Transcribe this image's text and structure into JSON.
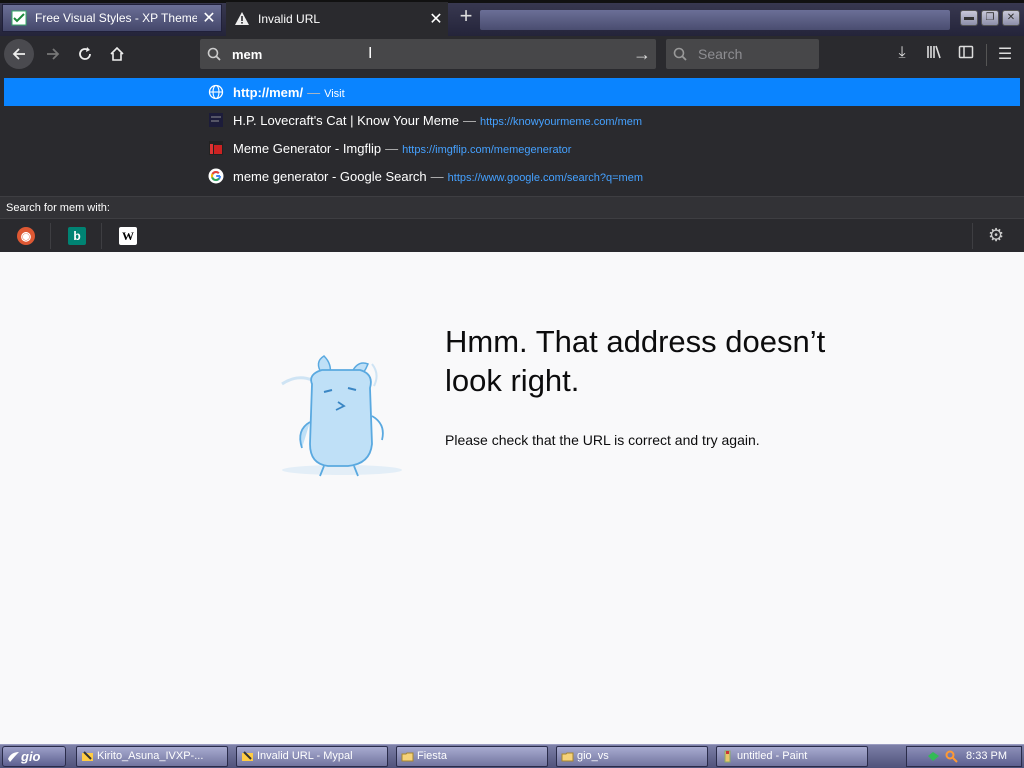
{
  "browser": {
    "tabs": [
      {
        "label": "Free Visual Styles - XP Themes - F",
        "active": false
      },
      {
        "label": "Invalid URL",
        "active": true
      }
    ],
    "new_tab_label": "+"
  },
  "toolbar": {
    "url_value": "mem",
    "search_placeholder": "Search"
  },
  "autocomplete": {
    "items": [
      {
        "title": "http://mem/",
        "separator": "—",
        "action": "Visit",
        "url": "",
        "icon": "globe-icon",
        "selected": true
      },
      {
        "title": "H.P. Lovecraft's Cat | Know Your Meme",
        "separator": "—",
        "action": "",
        "url": "https://knowyourmeme.com/mem",
        "icon": "knowyourmeme-icon",
        "selected": false
      },
      {
        "title": "Meme Generator - Imgflip",
        "separator": "—",
        "action": "",
        "url": "https://imgflip.com/memegenerator",
        "icon": "imgflip-icon",
        "selected": false
      },
      {
        "title": "meme generator - Google Search",
        "separator": "—",
        "action": "",
        "url": "https://www.google.com/search?q=mem",
        "icon": "google-icon",
        "selected": false
      }
    ],
    "search_with_label": "Search for mem with:",
    "engines": [
      "duckduckgo-icon",
      "bing-icon",
      "wikipedia-icon"
    ]
  },
  "error_page": {
    "title": "Hmm. That address doesn’t look right.",
    "description": "Please check that the URL is correct and try again."
  },
  "taskbar": {
    "start_label": "gio",
    "tasks": [
      {
        "label": "Kirito_Asuna_IVXP-..."
      },
      {
        "label": "Invalid URL - Mypal"
      },
      {
        "label": "Fiesta"
      },
      {
        "label": "gio_vs"
      },
      {
        "label": "untitled - Paint"
      }
    ],
    "clock": "8:33 PM"
  },
  "colors": {
    "accent": "#0a84ff",
    "toolbar_bg": "#2a2a2e",
    "link": "#45a1ff"
  }
}
